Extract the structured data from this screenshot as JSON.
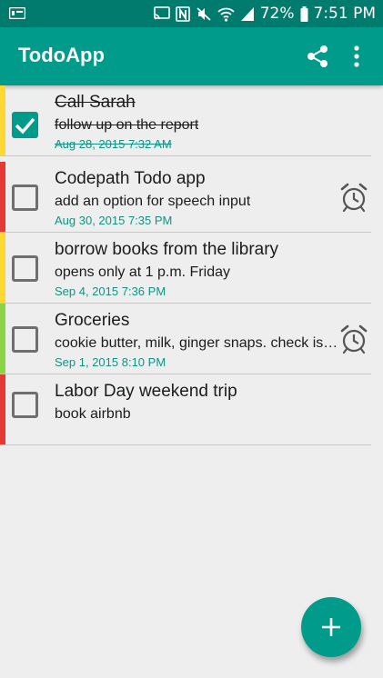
{
  "status_bar": {
    "battery_text": "72%",
    "time": "7:51 PM"
  },
  "app_bar": {
    "title": "TodoApp",
    "share_icon": "share-icon",
    "more_icon": "more-vert-icon"
  },
  "colors": {
    "primary": "#009b8a",
    "primary_dark": "#007b6e",
    "date_text": "#0f9485",
    "priority_high": "#e53935",
    "priority_medium": "#fdd835",
    "priority_low": "#8bd44a"
  },
  "todos": [
    {
      "title": "Call Sarah",
      "note": "follow up on the report",
      "date": "Aug 28, 2015 7:32 AM",
      "checked": true,
      "priority": "medium",
      "alarm": false
    },
    {
      "title": "Codepath Todo app",
      "note": "add an option for speech input",
      "date": "Aug 30, 2015 7:35 PM",
      "checked": false,
      "priority": "high",
      "alarm": true
    },
    {
      "title": "borrow books from the library",
      "note": "opens only at 1 p.m. Friday",
      "date": "Sep 4, 2015 7:36 PM",
      "checked": false,
      "priority": "medium",
      "alarm": false
    },
    {
      "title": "Groceries",
      "note": "cookie butter, milk, ginger snaps. check is…",
      "date": "Sep 1, 2015 8:10 PM",
      "checked": false,
      "priority": "low",
      "alarm": true
    },
    {
      "title": "Labor Day weekend trip",
      "note": "book airbnb",
      "date": "",
      "checked": false,
      "priority": "high",
      "alarm": false
    }
  ],
  "fab": {
    "icon": "plus-icon"
  }
}
